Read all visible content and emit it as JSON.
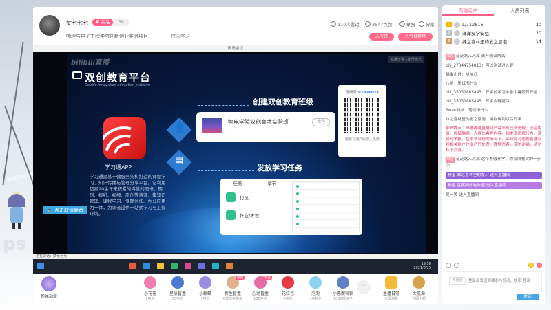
{
  "room": {
    "streamer_name": "梦七七七",
    "follow_label": "关注",
    "follow_count": "38",
    "title": "物理与电子工程学院创新创业实验项目",
    "category": "校园学习",
    "stats": [
      {
        "icon": "eye-icon",
        "text": "110人看过"
      },
      {
        "icon": "heart-icon",
        "text": "3547点赞"
      },
      {
        "icon": "report-icon",
        "text": "举报"
      },
      {
        "icon": "share-icon",
        "text": "分享"
      }
    ],
    "rank_pills": [
      "人气榜",
      "人气推荐榜"
    ]
  },
  "video": {
    "window_title": "腾讯会议",
    "watermark": "bilibili直播",
    "corner_tag": "直播已进入全屏模式",
    "slide": {
      "title": "双创教育平台",
      "subtitle": "Double innovation education platform",
      "app_label": "学习通APP",
      "app_desc": "学习通是基于微服务架构打造的课程学习、知识传播与管理分享平台。它利用超星20余年来积累的海量的图书、期刊、报纸、视频、原创等资源，集知识管理、课程学习、专题创作、办公应用为一体，为读者提供一站式学习与工作环境。",
      "step1": "创建双创教育班级",
      "step2": "发放学习任务",
      "class_name": "物电学院双创育才实验班",
      "class_button": "课程",
      "qr_header_pre": "班级号",
      "qr_header_code": "92826071",
      "qr_footer": "用学习通扫码加入班级",
      "task_tabs": [
        "任务",
        "章节"
      ],
      "tasks": [
        "讨论",
        "作业/考试"
      ]
    },
    "unmute_label": "点击取消静音",
    "mini_taskbar_text": "正在讲话：梦七七七",
    "clock": "19:58\n2021/3/25"
  },
  "gifts": [
    {
      "name": "小花花",
      "price": "1电池",
      "badge": "",
      "color": "#f07fb0"
    },
    {
      "name": "星愿盲盒",
      "price": "50电池",
      "badge": "",
      "color": "#4a7bd1"
    },
    {
      "name": "小蝴蝶",
      "price": "1电池",
      "badge": "",
      "color": "#9c8de3"
    },
    {
      "name": "新生盲盒",
      "price": "0银瓜子购买",
      "badge": "限免",
      "color": "#e0b18a"
    },
    {
      "name": "心动盲盒",
      "price": "150电池",
      "badge": "新品",
      "color": "#e46aa8"
    },
    {
      "name": "花红包",
      "price": "0电池",
      "badge": "",
      "color": "#e83a45"
    },
    {
      "name": "泡泡",
      "price": "10电池",
      "badge": "",
      "color": "#8fd1f0"
    },
    {
      "name": "小恶魔铃铛",
      "price": "2000银瓜子",
      "badge": "",
      "color": "#5f7fc9"
    }
  ],
  "gift_extras": [
    {
      "name": "主播日常",
      "price": "立即观看",
      "color": "#f5b93a"
    },
    {
      "name": "大航海",
      "price": "立即上船",
      "color": "#d9a24a"
    }
  ],
  "fanclub_label": "粉丝勋章",
  "chat": {
    "tabs": [
      "高能用户",
      "人员列表"
    ],
    "rank": [
      {
        "name": "L/712816",
        "score": "30"
      },
      {
        "name": "洋洋没学安组",
        "score": "30"
      },
      {
        "name": "妹之喜林里的发之恩泡",
        "score": "14"
      }
    ],
    "messages": [
      {
        "type": "enter",
        "text": "泛泛路人入浑  离开测试两试"
      },
      {
        "type": "plain",
        "text": "bili_27344754813：可以测试进入群"
      },
      {
        "type": "plain",
        "text": "猫猫小月：哈哈😊"
      },
      {
        "type": "plain",
        "text": "八组：笔试书什么"
      },
      {
        "type": "plain",
        "text": "bili_35031863845：开学前学习准备个暑假假开始"
      },
      {
        "type": "plain",
        "text": "bili_35031863845：开学会有题目"
      },
      {
        "type": "plain",
        "text": "Swan科技：笔试书什么"
      },
      {
        "type": "plain",
        "text": "妹之喜林里的发之恩泡：讲你讲到以后同学"
      },
      {
        "type": "notice",
        "text": "系统提示：哔哩哔哩直播间严禁出现违法违规、低俗色情、吸烟酗酒、人身伤害等内容。如发现违规行为，请及时举报。在依法合规的情况下，平台将对违规直播间和相关账户作出严厉处罚。理性消费，谨防诈骗，请勿私下交易。"
      },
      {
        "type": "enter",
        "text": "泛泛路人入浑  这个暑假开学，你会很充实的一步😊"
      },
      {
        "type": "hl",
        "text": "粉星  妹之喜林里的发...  进入直播间"
      },
      {
        "type": "hl2",
        "text": "粉星  豆腐脑好吃欢迎  进入直播间"
      },
      {
        "type": "plain",
        "text": "笑一笑 进入直播间"
      }
    ],
    "input_badge": "未登录",
    "input_placeholder": "登录后发送弹幕参与互动，快来 登录",
    "send_label": "发送"
  }
}
